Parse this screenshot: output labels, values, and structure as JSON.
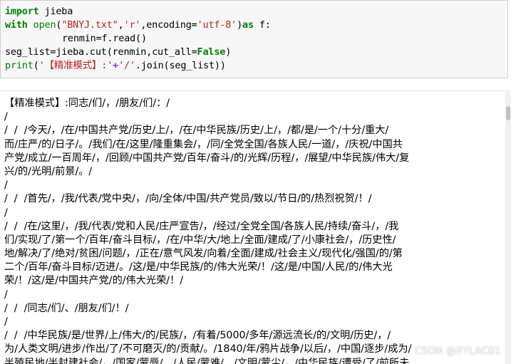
{
  "code": {
    "line1": {
      "kw": "import",
      "rest": " jieba"
    },
    "line2": {
      "kw": "with",
      "sp": " ",
      "fn": "open",
      "p1": "(",
      "s1": "\"BNYJ.txt\"",
      "c1": ",",
      "s2": "'r'",
      "c2": ",encoding=",
      "s3": "'utf-8'",
      "p2": ")",
      "as": "as",
      "rest": " f:"
    },
    "line3": {
      "code": "renmin=f.read()"
    },
    "line4": {
      "a": "seg_list=jieba.cut(renmin,cut_all=",
      "flag": "False",
      "b": ")"
    },
    "line5": {
      "fn": "print",
      "p1": "(",
      "s1": "'【精准模式】:'",
      "op": "+",
      "s2": "'/'",
      "rest": ".join(seg_list))"
    }
  },
  "output": {
    "lines": [
      "【精准模式】:同志/们/，/朋友/们/：/",
      "/",
      "/  /  /今天/，/在/中国共产党/历史/上/，/在/中华民族/历史/上/，/都/是/一个/十分/重大/",
      "而/庄严/的/日子/。/我们/在/这里/隆重集会/，/同/全党全国/各族人民/一道/，/庆祝/中国共",
      "产党/成立/一百周年/，/回顾/中国共产党/百年/奋斗/的/光辉/历程/，/展望/中华民族/伟大/复",
      "兴/的/光明/前景/。/",
      "/",
      "/  /  /首先/，/我/代表/党中央/，/向/全体/中国/共产党员/致以/节日/的/热烈祝贺/！/",
      "/",
      "/  /  /在/这里/，/我/代表/党和人民/庄严宣告/，/经过/全党全国/各族人民/持续/奋斗/，/我",
      "们/实现/了/第一个/百年/奋斗目标/，/在/中华/大/地上/全面/建成/了/小康社会/，/历史性/",
      "地/解决/了/绝对/贫困/问题/，/正在/意气风发/向着/全面/建成/社会主义/现代化/强国/的/第",
      "二个/百年/奋斗目标/迈进/。/这/是/中华民族/的/伟大光荣/！/这/是/中国/人民/的/伟大光",
      "荣/！/这/是/中国共产党/的/伟大光荣/！/",
      "/",
      "/  /  /同志/们/、/朋友/们/！/",
      "/",
      "/  /  /中华民族/是/世界/上/伟大/的/民族/，/有着/5000/多年/源远流长/的/文明/历史/，/",
      "为/人类文明/进步/作出/了/不可磨灭/的/贡献/。/1840/年/鸦片战争/以后/，/中国/逐步/成为/",
      "半殖民地/半封建社会/，/国家/蒙辱/、/人民/蒙难/、/文明/蒙尘/，/中华民族/遭受/了/前所未"
    ]
  },
  "watermark": "CSDN @XYLAC01"
}
